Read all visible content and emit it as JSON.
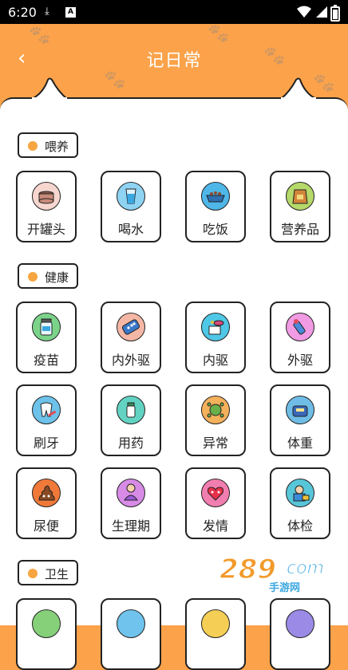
{
  "status_bar": {
    "time": "6:20",
    "icons": [
      "download-icon",
      "a-notification-icon",
      "wifi-icon",
      "signal-icon",
      "battery-icon"
    ]
  },
  "header": {
    "title": "记日常",
    "back_icon": "chevron-left-icon"
  },
  "colors": {
    "accent": "#fba24a",
    "dot": "#f7a540",
    "outline": "#222222"
  },
  "sections": [
    {
      "label": "喂养",
      "items": [
        {
          "label": "开罐头",
          "icon": "canned-food-icon",
          "color": "#f6d6cf"
        },
        {
          "label": "喝水",
          "icon": "water-glass-icon",
          "color": "#8fd3f3"
        },
        {
          "label": "吃饭",
          "icon": "food-bowl-icon",
          "color": "#4fb6e8"
        },
        {
          "label": "营养品",
          "icon": "supplement-bag-icon",
          "color": "#b5d96a"
        }
      ]
    },
    {
      "label": "健康",
      "items": [
        {
          "label": "疫苗",
          "icon": "vaccine-bottle-icon",
          "color": "#7bd38a"
        },
        {
          "label": "内外驱",
          "icon": "pill-pack-icon",
          "color": "#f5b7a5"
        },
        {
          "label": "内驱",
          "icon": "internal-deworm-icon",
          "color": "#4fc7e6"
        },
        {
          "label": "外驱",
          "icon": "external-deworm-icon",
          "color": "#f09be3"
        },
        {
          "label": "刷牙",
          "icon": "toothbrush-icon",
          "color": "#6dc2ea"
        },
        {
          "label": "用药",
          "icon": "medicine-icon",
          "color": "#62d3c3"
        },
        {
          "label": "异常",
          "icon": "abnormal-virus-icon",
          "color": "#f4b15c"
        },
        {
          "label": "体重",
          "icon": "weight-scale-icon",
          "color": "#6fbde6"
        },
        {
          "label": "尿便",
          "icon": "poop-icon",
          "color": "#f0793a"
        },
        {
          "label": "生理期",
          "icon": "period-icon",
          "color": "#d78be6"
        },
        {
          "label": "发情",
          "icon": "heat-heart-icon",
          "color": "#f27eb0"
        },
        {
          "label": "体检",
          "icon": "checkup-icon",
          "color": "#58c6d9"
        }
      ]
    },
    {
      "label": "卫生",
      "items": [
        {
          "label": "",
          "icon": "hygiene-green-icon",
          "color": "#86d07a"
        },
        {
          "label": "",
          "icon": "hygiene-blue-icon",
          "color": "#6fc3ec"
        },
        {
          "label": "",
          "icon": "hygiene-yellow-icon",
          "color": "#f5cf55"
        },
        {
          "label": "",
          "icon": "hygiene-purple-icon",
          "color": "#9b8be6"
        }
      ]
    }
  ],
  "watermark": {
    "number": "289",
    "domain": "com",
    "sub": "手游网"
  }
}
